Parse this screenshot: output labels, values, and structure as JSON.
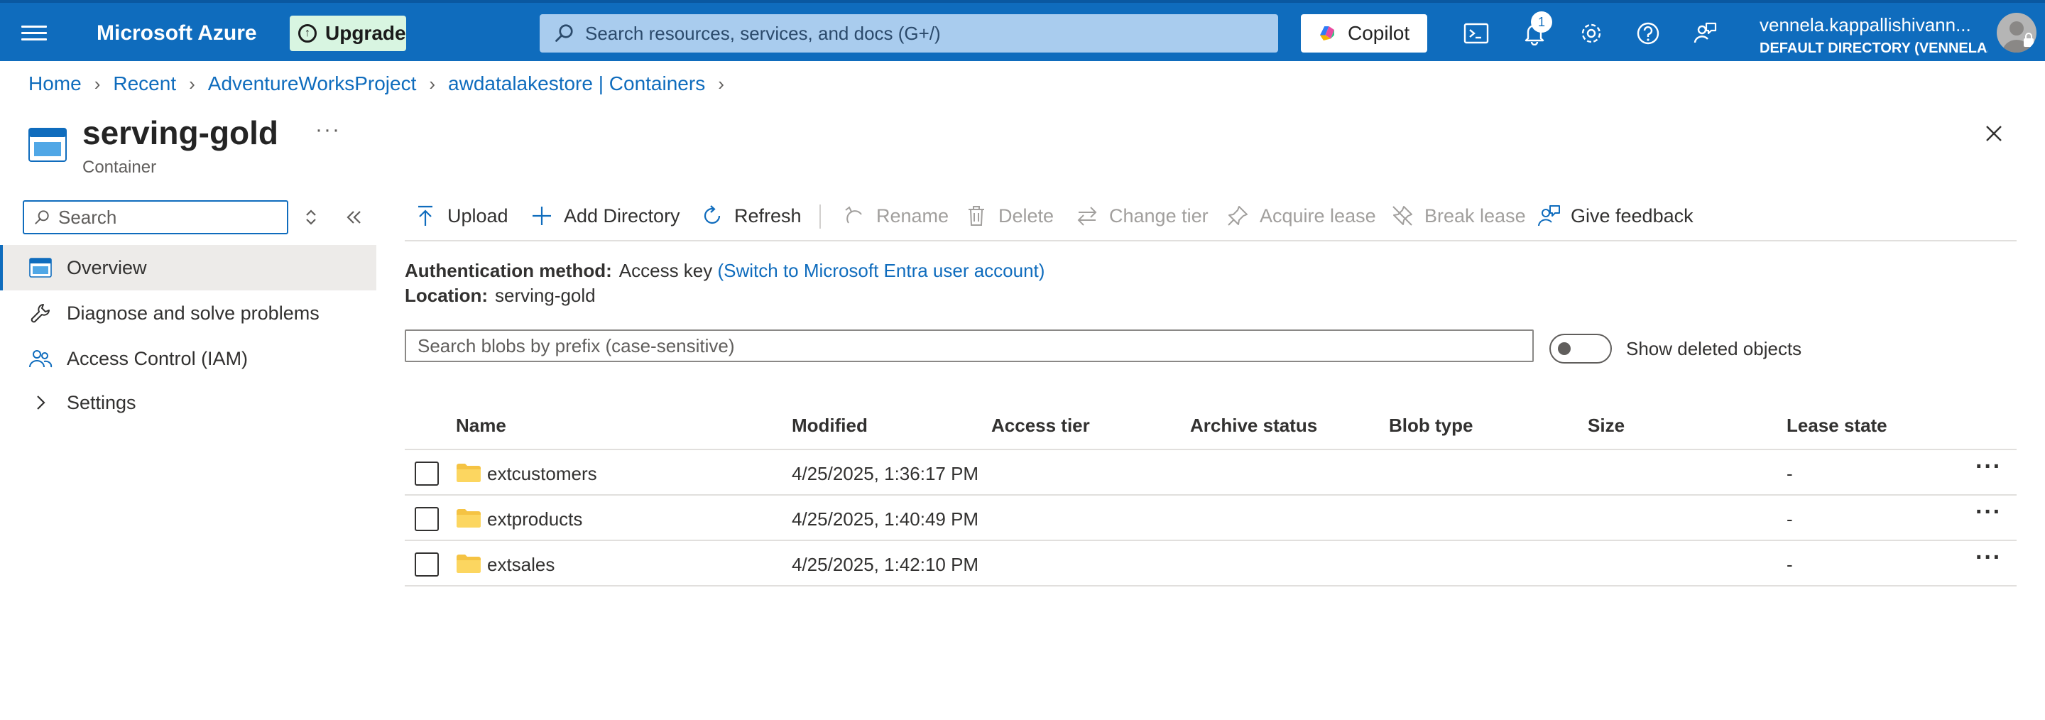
{
  "topbar": {
    "brand": "Microsoft Azure",
    "upgrade_label": "Upgrade",
    "search_placeholder": "Search resources, services, and docs (G+/)",
    "copilot_label": "Copilot",
    "notification_count": "1",
    "user": "vennela.kappallishivann...",
    "directory": "DEFAULT DIRECTORY (VENNELA...",
    "bar_color": "#0f6cbd"
  },
  "breadcrumb": [
    "Home",
    "Recent",
    "AdventureWorksProject",
    "awdatalakestore | Containers"
  ],
  "title": "serving-gold",
  "subtitle": "Container",
  "nav": {
    "search_placeholder": "Search",
    "items": [
      {
        "label": "Overview",
        "icon": "container-icon",
        "active": true
      },
      {
        "label": "Diagnose and solve problems",
        "icon": "wrench-icon"
      },
      {
        "label": "Access Control (IAM)",
        "icon": "people-icon"
      },
      {
        "label": "Settings",
        "icon": "chevron-right-icon"
      }
    ]
  },
  "toolbar": {
    "upload": "Upload",
    "add_directory": "Add Directory",
    "refresh": "Refresh",
    "rename": "Rename",
    "delete": "Delete",
    "change_tier": "Change tier",
    "acquire_lease": "Acquire lease",
    "break_lease": "Break lease",
    "give_feedback": "Give feedback"
  },
  "info": {
    "auth_label": "Authentication method:",
    "auth_value": "Access key",
    "auth_link": "(Switch to Microsoft Entra user account)",
    "location_label": "Location:",
    "location_value": "serving-gold"
  },
  "blob_search_placeholder": "Search blobs by prefix (case-sensitive)",
  "show_deleted_label": "Show deleted objects",
  "table": {
    "columns": [
      "Name",
      "Modified",
      "Access tier",
      "Archive status",
      "Blob type",
      "Size",
      "Lease state"
    ],
    "rows": [
      {
        "name": "extcustomers",
        "modified": "4/25/2025, 1:36:17 PM",
        "lease_state": "-"
      },
      {
        "name": "extproducts",
        "modified": "4/25/2025, 1:40:49 PM",
        "lease_state": "-"
      },
      {
        "name": "extsales",
        "modified": "4/25/2025, 1:42:10 PM",
        "lease_state": "-"
      }
    ]
  }
}
